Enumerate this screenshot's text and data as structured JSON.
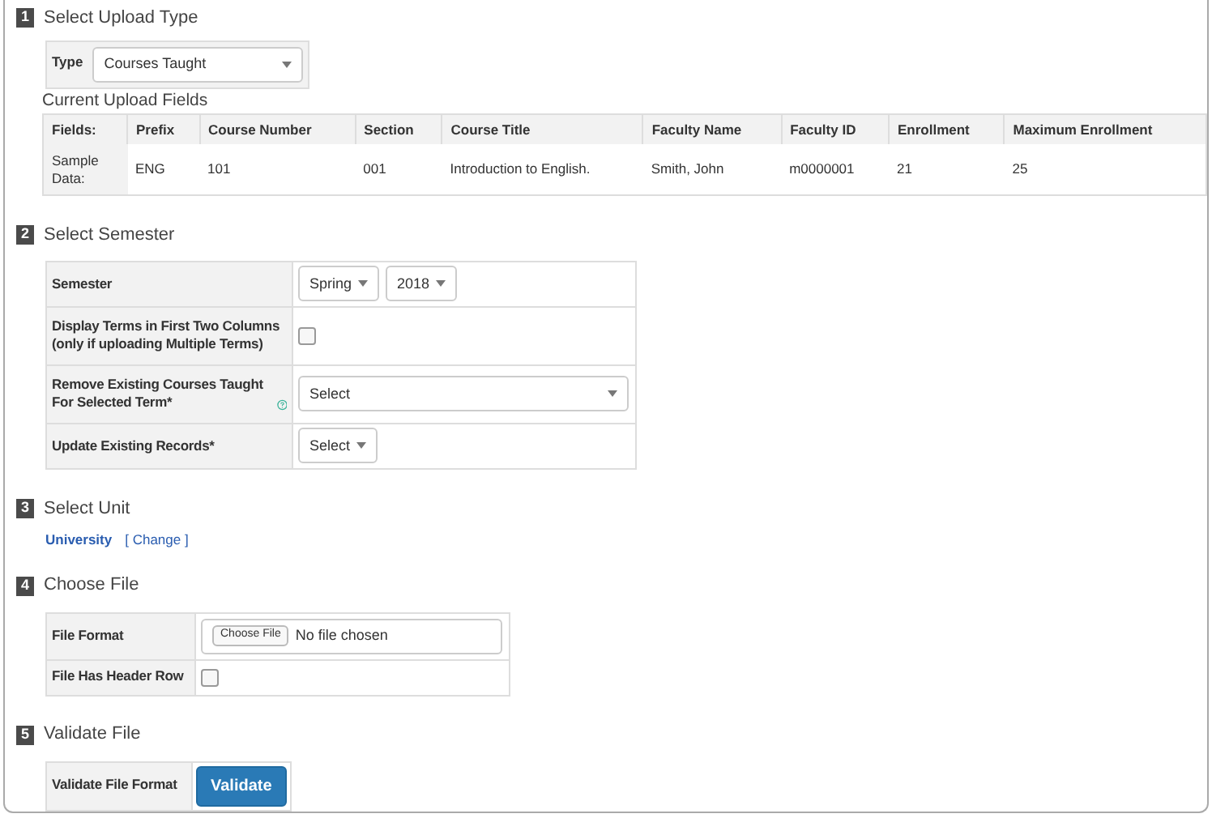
{
  "sections": [
    {
      "number": "1",
      "title": "Select Upload Type",
      "kind": "upload-type",
      "type_field": {
        "label": "Type",
        "value": "Courses Taught"
      },
      "subtitle": "Current Upload Fields",
      "table": {
        "columns": [
          "Fields:",
          "Prefix",
          "Course Number",
          "Section",
          "Course Title",
          "Faculty Name",
          "Faculty ID",
          "Enrollment",
          "Maximum Enrollment"
        ],
        "rows": [
          [
            "Sample Data:",
            "ENG",
            "101",
            "001",
            "Introduction to English.",
            "Smith, John",
            "m0000001",
            "21",
            "25"
          ]
        ]
      }
    },
    {
      "number": "2",
      "title": "Select Semester",
      "kind": "form",
      "rows": [
        {
          "kind": "dropdowns",
          "label": "Semester",
          "values": [
            "Spring",
            "2018"
          ]
        },
        {
          "kind": "checkbox",
          "label": "Display Terms in First Two Columns (only if uploading Multiple Terms)",
          "checked": false
        },
        {
          "kind": "wide-select",
          "label": "Remove Existing Courses Taught For Selected Term*",
          "help": true,
          "value": "Select"
        },
        {
          "kind": "dropdowns",
          "label": "Update Existing Records*",
          "values": [
            "Select"
          ]
        }
      ]
    },
    {
      "number": "3",
      "title": "Select Unit",
      "kind": "unit",
      "unit": "University",
      "link": "[ Change ]"
    },
    {
      "number": "4",
      "title": "Choose File",
      "kind": "form",
      "rows": [
        {
          "kind": "file",
          "label": "File Format",
          "button": "Choose File",
          "status": "No file chosen"
        },
        {
          "kind": "checkbox",
          "label": "File Has Header Row",
          "checked": false
        }
      ]
    },
    {
      "number": "5",
      "title": "Validate File",
      "kind": "form",
      "rows": [
        {
          "kind": "button",
          "label": "Validate File Format",
          "button": "Validate"
        }
      ]
    }
  ]
}
